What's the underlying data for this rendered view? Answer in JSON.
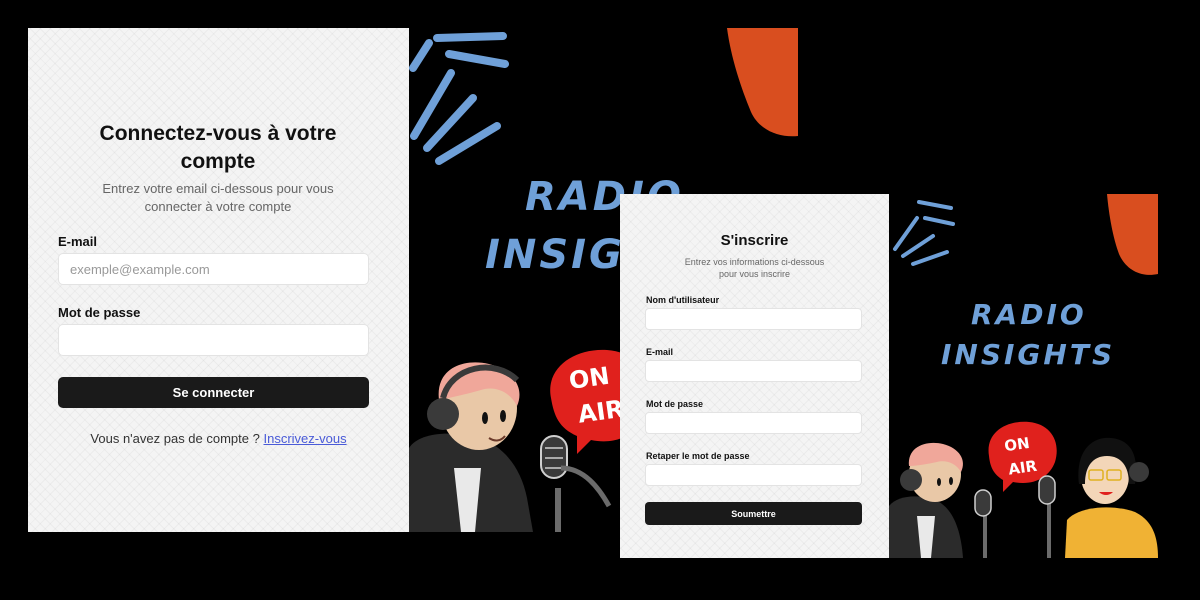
{
  "login": {
    "title": "Connectez-vous à votre compte",
    "subtitle": "Entrez votre email ci-dessous pour vous connecter à votre compte",
    "email_label": "E-mail",
    "email_placeholder": "exemple@example.com",
    "email_value": "",
    "password_label": "Mot de passe",
    "password_value": "",
    "submit_label": "Se connecter",
    "footer_text": "Vous n'avez pas de compte ?",
    "footer_link": "Inscrivez-vous"
  },
  "signup": {
    "title": "S'inscrire",
    "subtitle": "Entrez vos informations ci-dessous pour vous inscrire",
    "username_label": "Nom d'utilisateur",
    "email_label": "E-mail",
    "password_label": "Mot de passe",
    "confirm_label": "Retaper le mot de passe",
    "submit_label": "Soumettre"
  },
  "artwork": {
    "brand_line1": "RADIO",
    "brand_line2": "INSIGHTS",
    "badge_line1": "ON",
    "badge_line2": "AIR"
  },
  "colors": {
    "accent_blue": "#6fa0d8",
    "accent_orange": "#d94e1f",
    "badge_red": "#e0211d",
    "button_dark": "#1a1a1a",
    "link": "#4a5bd8"
  }
}
